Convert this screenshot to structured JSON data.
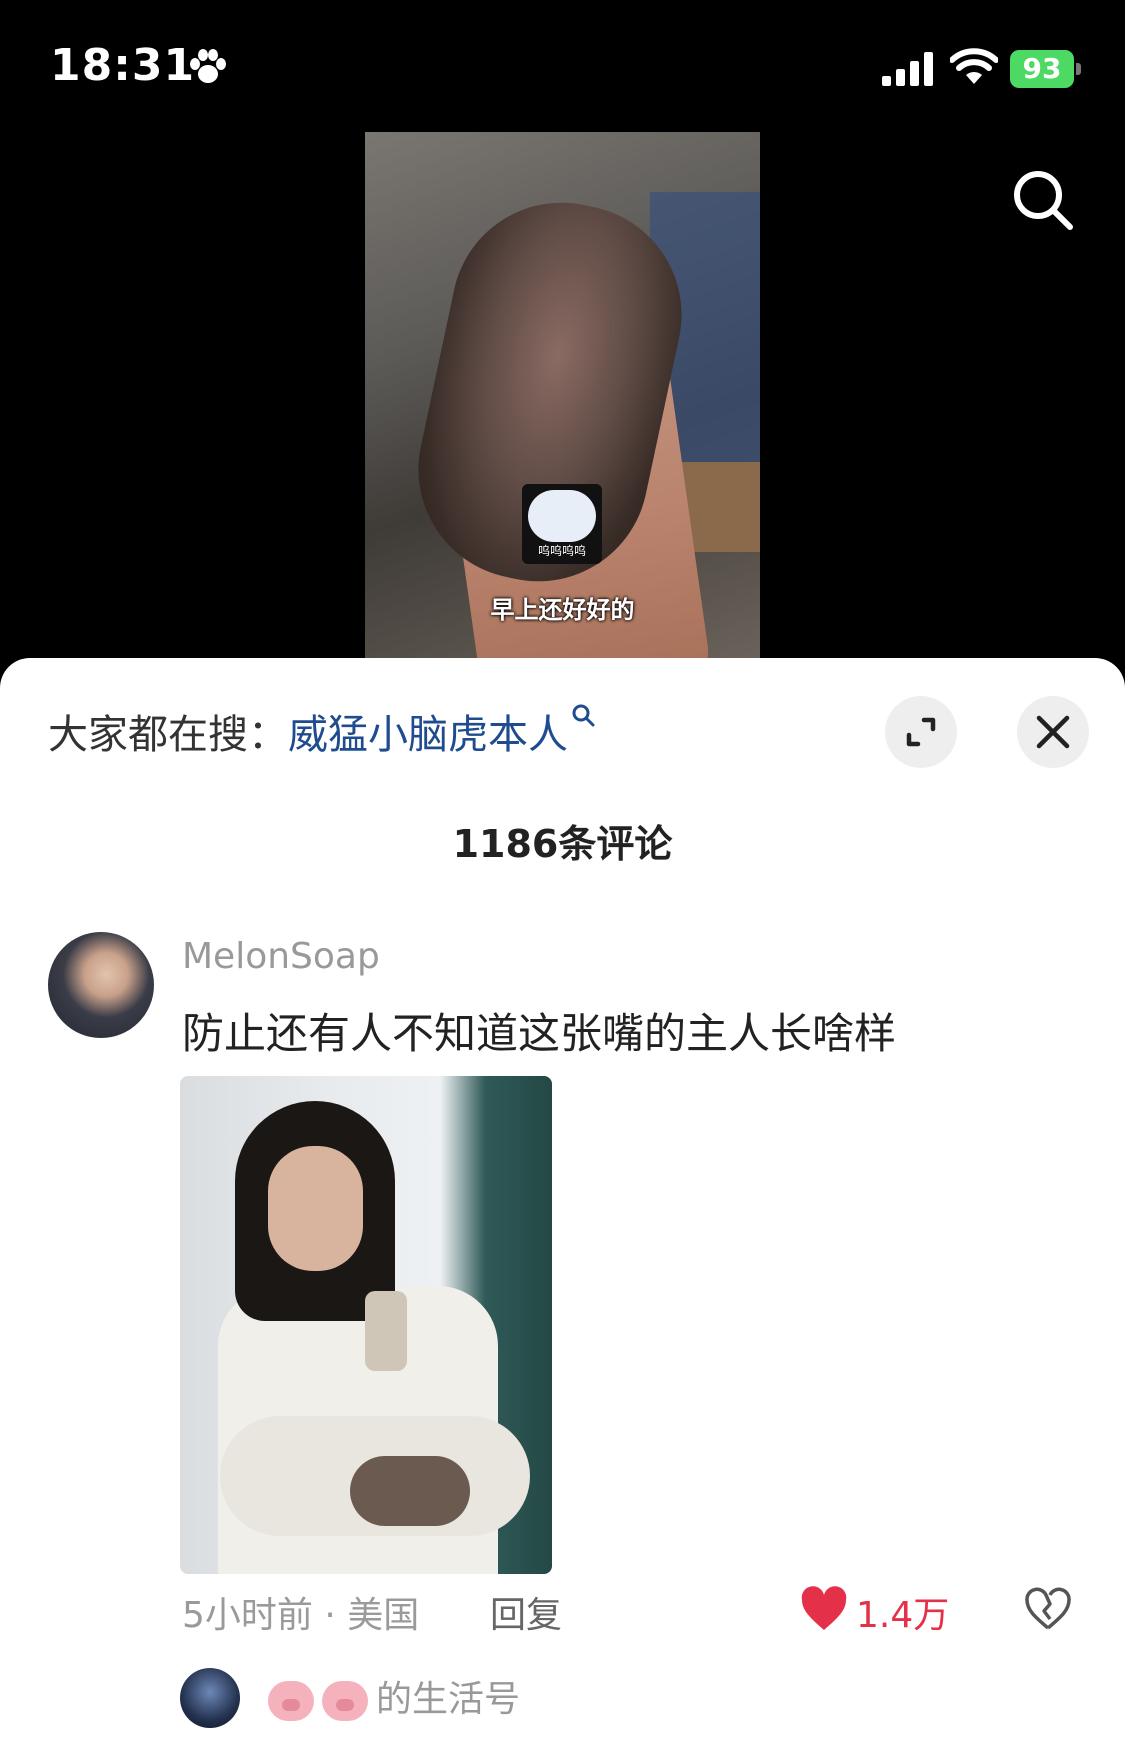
{
  "status_bar": {
    "time": "18:31",
    "battery": "93"
  },
  "video": {
    "caption": "早上还好好的",
    "sticker_text": "呜呜呜呜"
  },
  "sheet": {
    "hot_search_prefix": "大家都在搜：",
    "hot_search_keyword": "威猛小脑虎本人",
    "comment_count": "1186条评论"
  },
  "comment": {
    "username": "MelonSoap",
    "text": "防止还有人不知道这张嘴的主人长啥样",
    "time_location": "5小时前 · 美国",
    "reply_label": "回复",
    "likes": "1.4万"
  },
  "sub_reply": {
    "name_suffix": "的生活号"
  },
  "colors": {
    "accent_like": "#e5304a",
    "keyword": "#1f4b8f",
    "battery": "#4cd964"
  }
}
